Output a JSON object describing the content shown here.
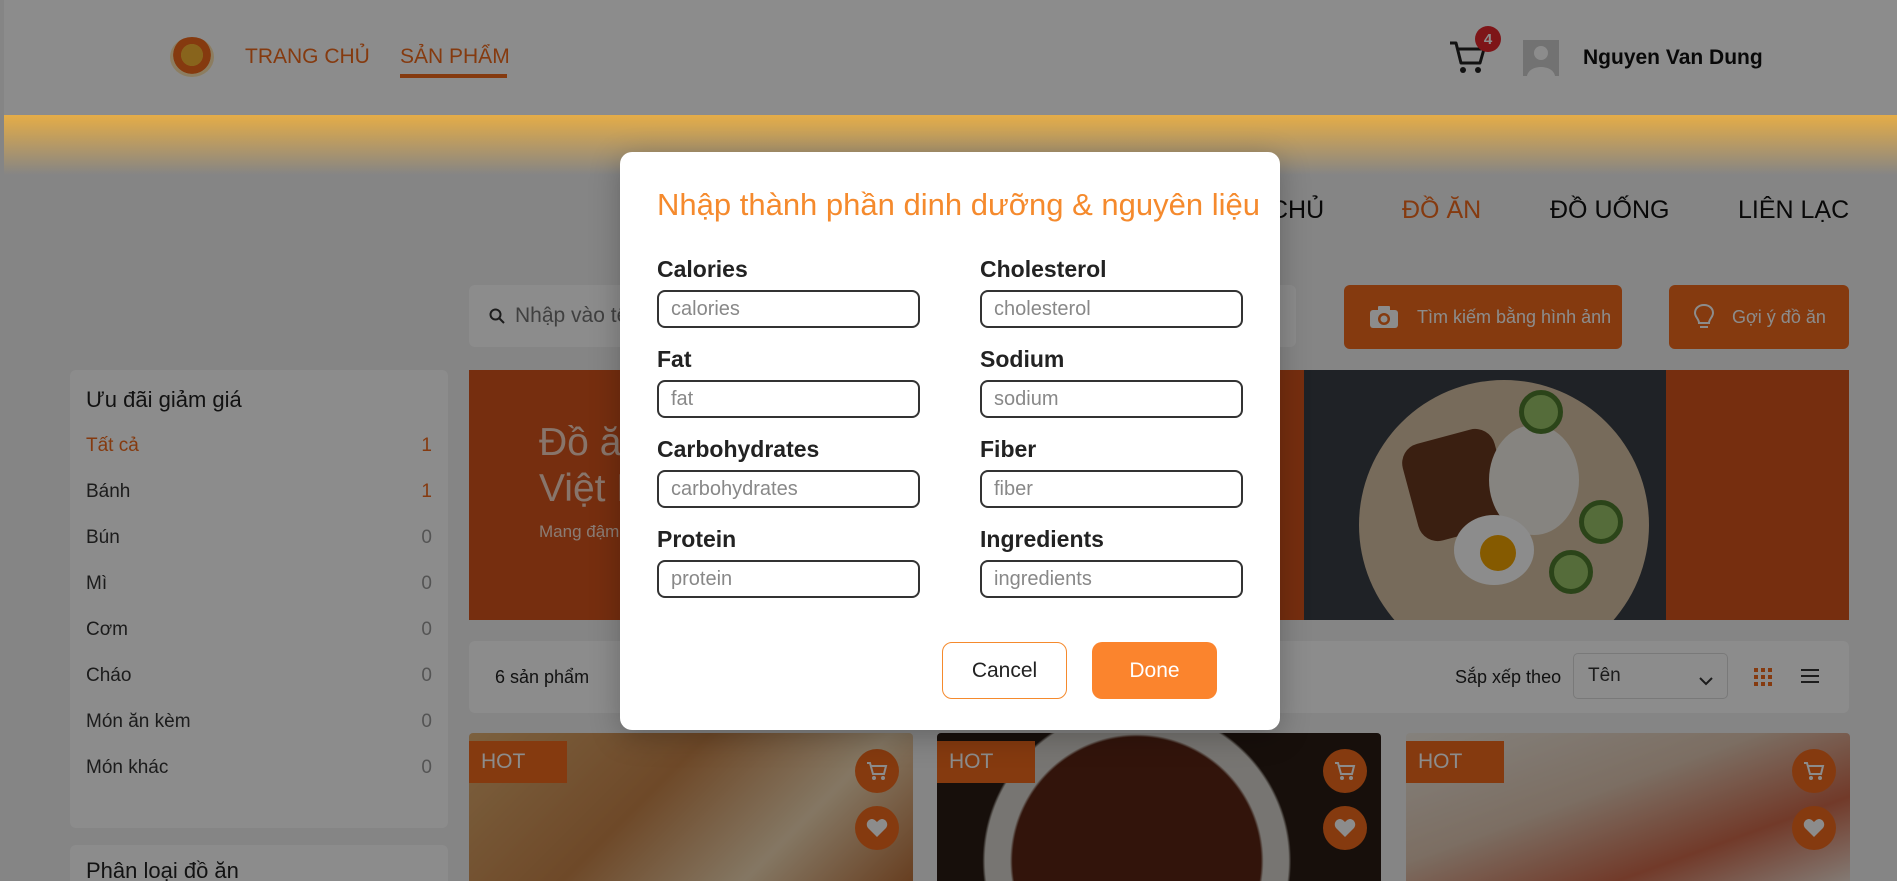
{
  "header": {
    "nav": {
      "home": "TRANG CHỦ",
      "products": "SẢN PHẨM"
    },
    "cart_count": "4",
    "user_name": "Nguyen Van Dung"
  },
  "subnav": {
    "home_partial": "CHỦ",
    "food": "ĐỒ ĂN",
    "drink": "ĐỒ UỐNG",
    "contact": "LIÊN LẠC"
  },
  "search": {
    "placeholder": "Nhập vào tên món ăn bạn muốn tìm",
    "image_search_label": "Tìm kiếm bằng hình ảnh",
    "suggest_label": "Gợi ý đồ ăn"
  },
  "sidebar": {
    "title": "Ưu đãi giảm giá",
    "items": [
      {
        "label": "Tất cả",
        "count": "1"
      },
      {
        "label": "Bánh",
        "count": "1"
      },
      {
        "label": "Bún",
        "count": "0"
      },
      {
        "label": "Mì",
        "count": "0"
      },
      {
        "label": "Cơm",
        "count": "0"
      },
      {
        "label": "Cháo",
        "count": "0"
      },
      {
        "label": "Món ăn kèm",
        "count": "0"
      },
      {
        "label": "Món khác",
        "count": "0"
      }
    ],
    "section2_title": "Phân loại đồ ăn"
  },
  "banner": {
    "title": "Đồ ăn\nViệt N",
    "subtitle": "Mang đậm"
  },
  "toolbar": {
    "product_count": "6 sản phẩm",
    "sort_label": "Sắp xếp theo",
    "sort_value": "Tên"
  },
  "cards": [
    {
      "tag": "HOT"
    },
    {
      "tag": "HOT"
    },
    {
      "tag": "HOT"
    }
  ],
  "modal": {
    "title": "Nhập thành phần dinh dưỡng & nguyên liệu",
    "fields": [
      {
        "label": "Calories",
        "placeholder": "calories"
      },
      {
        "label": "Cholesterol",
        "placeholder": "cholesterol"
      },
      {
        "label": "Fat",
        "placeholder": "fat"
      },
      {
        "label": "Sodium",
        "placeholder": "sodium"
      },
      {
        "label": "Carbohydrates",
        "placeholder": "carbohydrates"
      },
      {
        "label": "Fiber",
        "placeholder": "fiber"
      },
      {
        "label": "Protein",
        "placeholder": "protein"
      },
      {
        "label": "Ingredients",
        "placeholder": "ingredients"
      }
    ],
    "cancel_label": "Cancel",
    "done_label": "Done"
  },
  "colors": {
    "accent": "#f26b1d",
    "modal_title": "#f58a2d",
    "badge": "#e5272d"
  }
}
